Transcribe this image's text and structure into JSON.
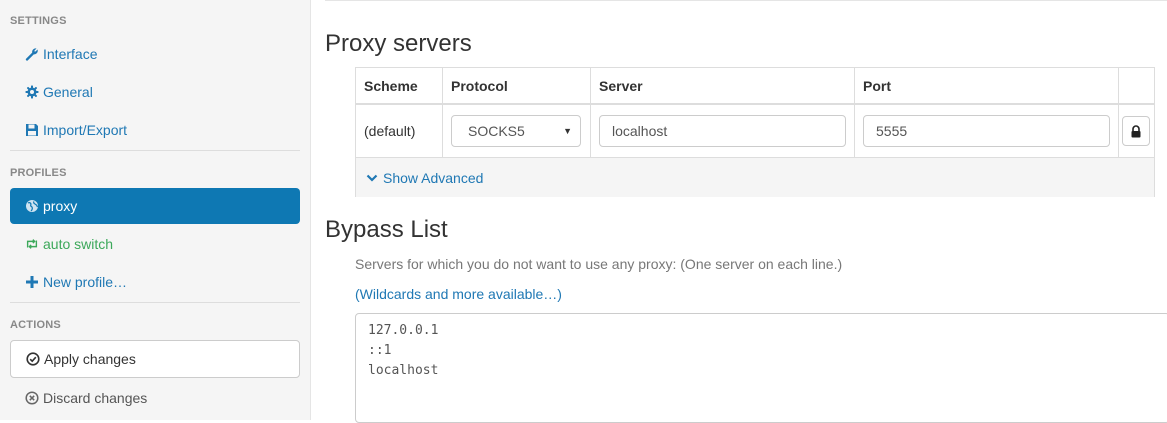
{
  "sidebar": {
    "settings_title": "SETTINGS",
    "settings_items": [
      {
        "label": "Interface",
        "icon": "wrench-icon"
      },
      {
        "label": "General",
        "icon": "gear-icon"
      },
      {
        "label": "Import/Export",
        "icon": "floppy-icon"
      }
    ],
    "profiles_title": "PROFILES",
    "profile_items": [
      {
        "label": "proxy",
        "icon": "globe-icon",
        "active": true
      },
      {
        "label": "auto switch",
        "icon": "retweet-icon"
      },
      {
        "label": "New profile…",
        "icon": "plus-icon"
      }
    ],
    "actions_title": "ACTIONS",
    "apply_label": "Apply changes",
    "discard_label": "Discard changes"
  },
  "main": {
    "proxy_title": "Proxy servers",
    "table": {
      "headers": [
        "Scheme",
        "Protocol",
        "Server",
        "Port"
      ],
      "row": {
        "scheme": "(default)",
        "protocol": "SOCKS5",
        "server": "localhost",
        "port": "5555"
      },
      "show_advanced": "Show Advanced"
    },
    "bypass_title": "Bypass List",
    "bypass_help": "Servers for which you do not want to use any proxy: (One server on each line.)",
    "bypass_link": "(Wildcards and more available…)",
    "bypass_lines": [
      "127.0.0.1",
      "::1",
      "localhost"
    ]
  },
  "colors": {
    "accent": "#0e78b3",
    "link": "#1f78b4",
    "green": "#3ca85a"
  }
}
